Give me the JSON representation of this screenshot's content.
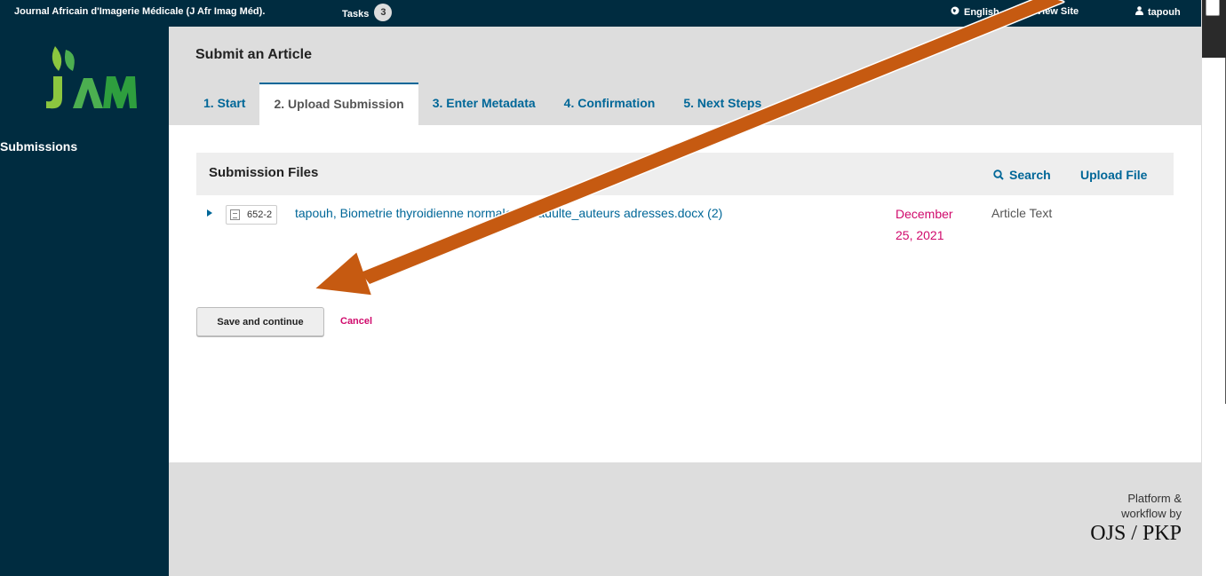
{
  "topbar": {
    "journal": "Journal Africain d'Imagerie Médicale (J Afr Imag Méd).",
    "tasks_label": "Tasks",
    "tasks_count": "3",
    "language": "English",
    "view_site": "View Site",
    "user": "tapouh"
  },
  "sidebar": {
    "logo_alt": "JAM",
    "items": [
      {
        "label": "Submissions"
      }
    ]
  },
  "header": {
    "title": "Submit an Article",
    "tabs": [
      {
        "label": "1. Start"
      },
      {
        "label": "2. Upload Submission",
        "active": true
      },
      {
        "label": "3. Enter Metadata"
      },
      {
        "label": "4. Confirmation"
      },
      {
        "label": "5. Next Steps"
      }
    ]
  },
  "submission_files": {
    "title": "Submission Files",
    "search": "Search",
    "upload": "Upload File",
    "files": [
      {
        "id": "652-2",
        "name": "tapouh, Biometrie thyroidienne normale de l'adulte_auteurs adresses.docx (2)",
        "date": "December 25, 2021",
        "type": "Article Text"
      }
    ]
  },
  "actions": {
    "save": "Save and continue",
    "cancel": "Cancel"
  },
  "footer": {
    "line1": "Platform &",
    "line2": "workflow by",
    "brand": "OJS / PKP"
  },
  "colors": {
    "navy": "#002c40",
    "link_blue": "#006798",
    "magenta": "#d00a6c",
    "annotation_orange": "#c65a11"
  }
}
